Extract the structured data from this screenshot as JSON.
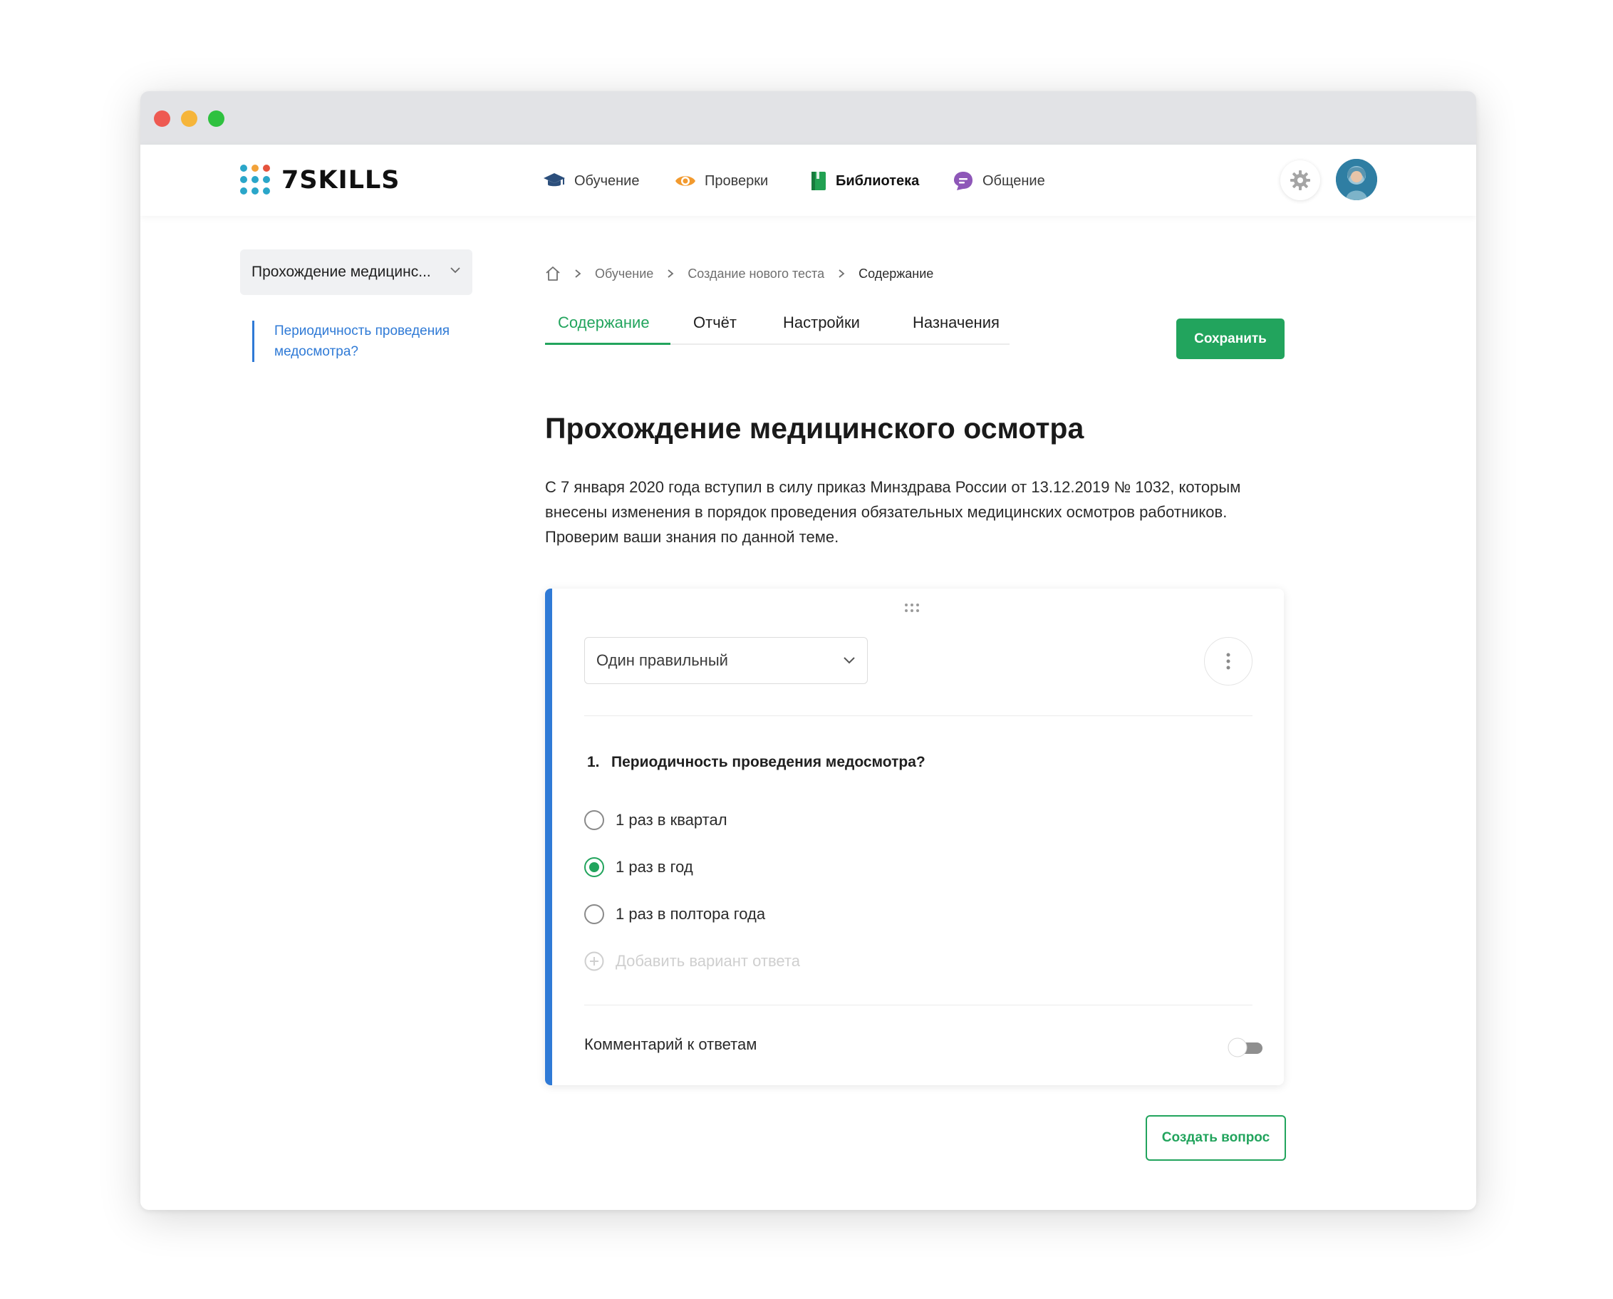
{
  "brand": {
    "name": "7SKILLS"
  },
  "nav": {
    "items": [
      {
        "label": "Обучение",
        "icon": "graduation-cap-icon",
        "active": false
      },
      {
        "label": "Проверки",
        "icon": "eye-icon",
        "active": false
      },
      {
        "label": "Библиотека",
        "icon": "book-icon",
        "active": true
      },
      {
        "label": "Общение",
        "icon": "chat-icon",
        "active": false
      }
    ]
  },
  "sidebar": {
    "dropdown_label": "Прохождение медицинс...",
    "items": [
      {
        "label": "Периодичность проведения медосмотра?"
      }
    ]
  },
  "breadcrumb": {
    "items": [
      "Обучение",
      "Создание нового теста"
    ],
    "current": "Содержание"
  },
  "tabs": [
    {
      "label": "Содержание",
      "active": true
    },
    {
      "label": "Отчёт",
      "active": false
    },
    {
      "label": "Настройки",
      "active": false
    },
    {
      "label": "Назначения",
      "active": false
    }
  ],
  "actions": {
    "save_label": "Сохранить",
    "create_question_label": "Создать вопрос"
  },
  "page": {
    "title": "Прохождение медицинского осмотра",
    "description": "С 7 января 2020 года вступил в силу приказ Минздрава России от 13.12.2019 № 1032, которым внесены изменения в порядок проведения обязательных медицинских осмотров работников. Проверим ваши знания по данной теме."
  },
  "question": {
    "type_label": "Один правильный",
    "number": "1.",
    "text": "Периодичность проведения медосмотра?",
    "options": [
      {
        "label": "1 раз в квартал",
        "checked": false
      },
      {
        "label": "1 раз в год",
        "checked": true
      },
      {
        "label": "1 раз в полтора года",
        "checked": false
      }
    ],
    "add_option_placeholder": "Добавить вариант ответа",
    "comment_label": "Комментарий к ответам",
    "comment_enabled": false
  },
  "colors": {
    "accent_green": "#22a45d",
    "accent_blue": "#2f7ad6"
  }
}
